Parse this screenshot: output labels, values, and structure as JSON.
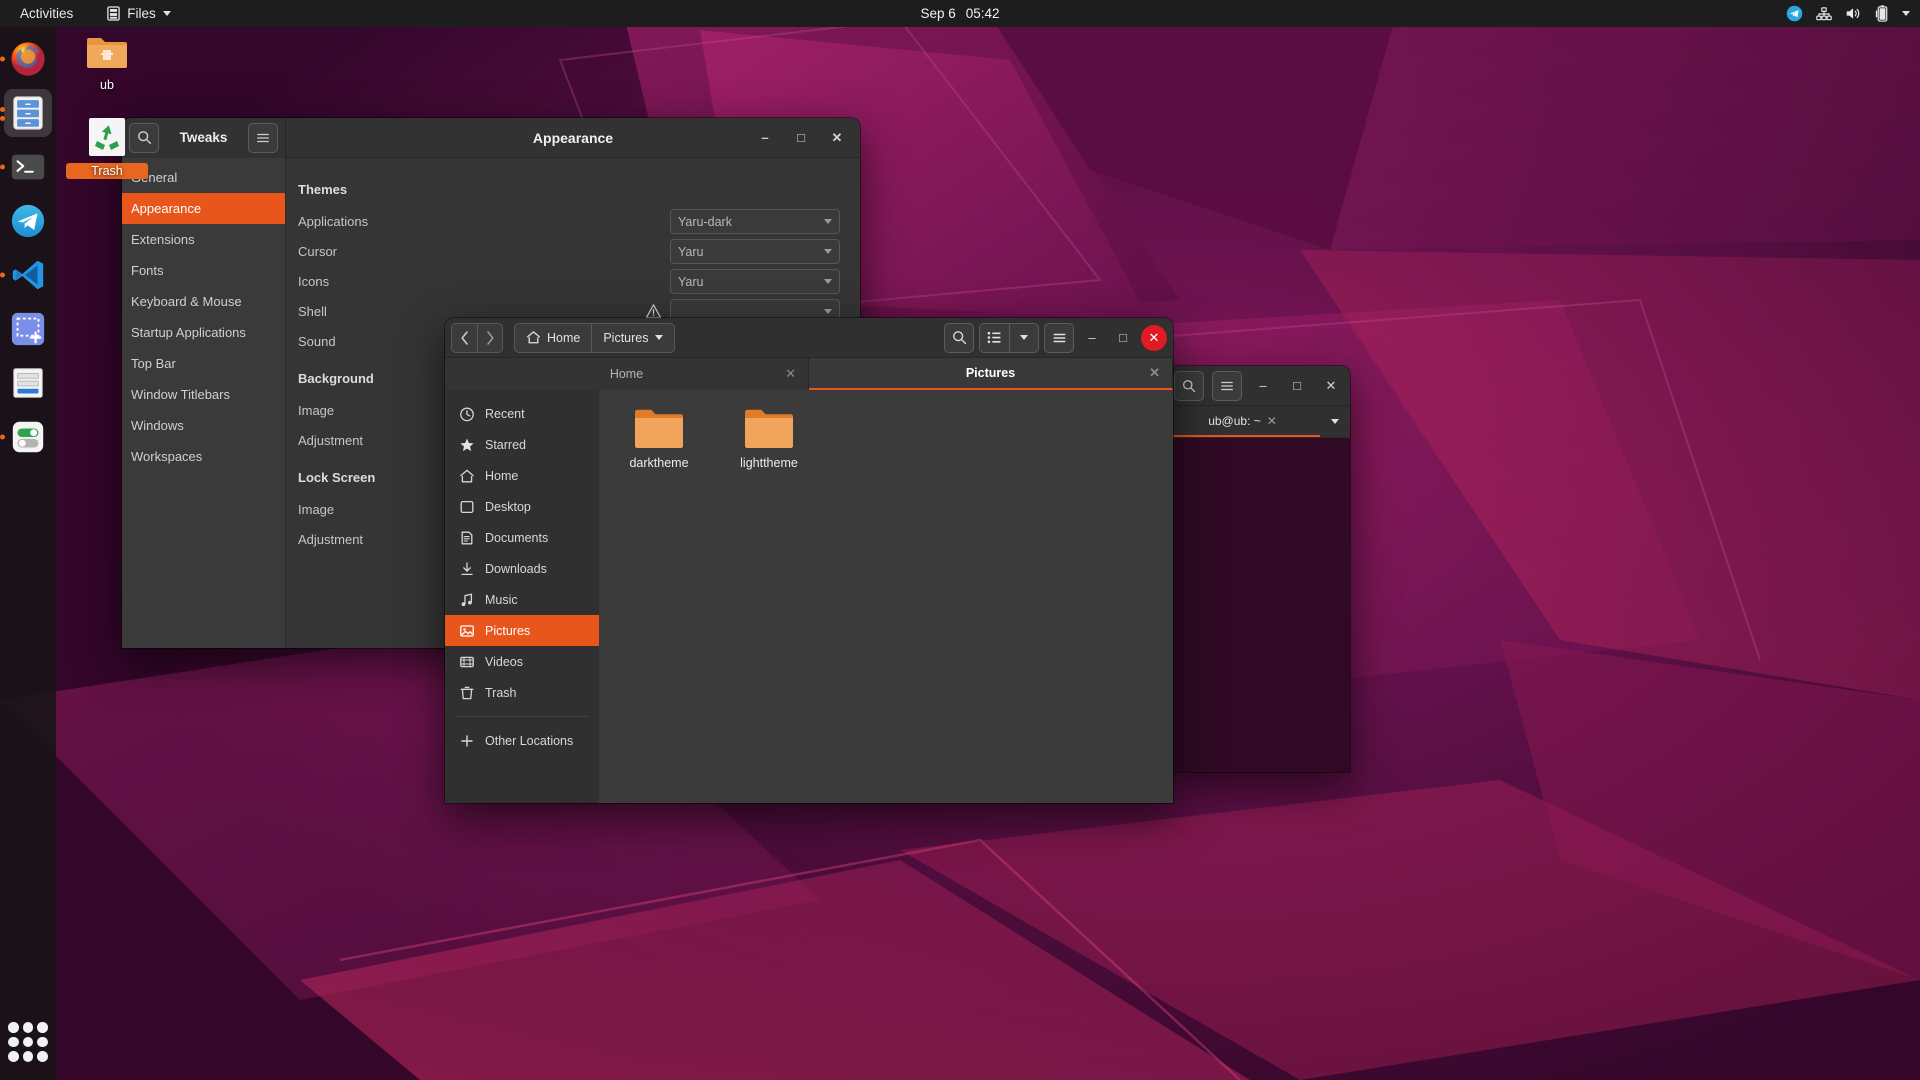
{
  "topbar": {
    "activities": "Activities",
    "app_menu": "Files",
    "app_menu_icon": "files-icon",
    "clock_date": "Sep 6",
    "clock_time": "05:42",
    "indicators": [
      {
        "name": "telegram-icon",
        "label": "Telegram"
      },
      {
        "name": "network-icon",
        "label": "Network"
      },
      {
        "name": "volume-icon",
        "label": "Volume"
      },
      {
        "name": "battery-icon",
        "label": "Battery"
      },
      {
        "name": "chevron-down-icon",
        "label": "System menu"
      }
    ]
  },
  "dock": {
    "items": [
      {
        "name": "firefox",
        "label": "Firefox",
        "running": true,
        "dots": 1,
        "active": false
      },
      {
        "name": "files",
        "label": "Files",
        "running": true,
        "dots": 2,
        "active": true
      },
      {
        "name": "terminal",
        "label": "Terminal",
        "running": true,
        "dots": 1,
        "active": false
      },
      {
        "name": "telegram",
        "label": "Telegram",
        "running": false,
        "dots": 0,
        "active": false
      },
      {
        "name": "vscode",
        "label": "Visual Studio Code",
        "running": true,
        "dots": 1,
        "active": false
      },
      {
        "name": "screenshot",
        "label": "Screenshot",
        "running": false,
        "dots": 0,
        "active": false
      },
      {
        "name": "forms",
        "label": "Forms",
        "running": false,
        "dots": 0,
        "active": false
      },
      {
        "name": "tweaks",
        "label": "Tweaks",
        "running": true,
        "dots": 1,
        "active": false
      }
    ],
    "show_apps_label": "Show Applications"
  },
  "desktop_icons": [
    {
      "name": "ub-folder",
      "label": "ub",
      "type": "folder"
    },
    {
      "name": "trash",
      "label": "Trash",
      "type": "trash"
    }
  ],
  "tweaks": {
    "title": "Tweaks",
    "page_title": "Appearance",
    "search_icon": "search-icon",
    "menu_icon": "hamburger-icon",
    "window_controls": [
      "minimize",
      "maximize",
      "close"
    ],
    "sidebar": [
      {
        "label": "General",
        "active": false
      },
      {
        "label": "Appearance",
        "active": true
      },
      {
        "label": "Extensions",
        "active": false
      },
      {
        "label": "Fonts",
        "active": false
      },
      {
        "label": "Keyboard & Mouse",
        "active": false
      },
      {
        "label": "Startup Applications",
        "active": false
      },
      {
        "label": "Top Bar",
        "active": false
      },
      {
        "label": "Window Titlebars",
        "active": false
      },
      {
        "label": "Windows",
        "active": false
      },
      {
        "label": "Workspaces",
        "active": false
      }
    ],
    "sections": [
      {
        "heading": "Themes",
        "rows": [
          {
            "label": "Applications",
            "value": "Yaru-dark",
            "control": "combo",
            "warning": false
          },
          {
            "label": "Cursor",
            "value": "Yaru",
            "control": "combo",
            "warning": false
          },
          {
            "label": "Icons",
            "value": "Yaru",
            "control": "combo",
            "warning": false
          },
          {
            "label": "Shell",
            "value": "",
            "control": "combo",
            "warning": true
          },
          {
            "label": "Sound",
            "value": "",
            "control": "combo",
            "warning": false
          }
        ]
      },
      {
        "heading": "Background",
        "rows": [
          {
            "label": "Image",
            "value": "",
            "control": "none",
            "warning": false
          },
          {
            "label": "Adjustment",
            "value": "",
            "control": "none",
            "warning": false
          }
        ]
      },
      {
        "heading": "Lock Screen",
        "rows": [
          {
            "label": "Image",
            "value": "",
            "control": "none",
            "warning": false
          },
          {
            "label": "Adjustment",
            "value": "",
            "control": "none",
            "warning": false
          }
        ]
      }
    ]
  },
  "files": {
    "back_icon": "chevron-left-icon",
    "forward_icon": "chevron-right-icon",
    "breadcrumbs": [
      {
        "label": "Home",
        "icon": "home-icon",
        "has_caret": false
      },
      {
        "label": "Pictures",
        "icon": "",
        "has_caret": true
      }
    ],
    "toolbar": [
      {
        "name": "search-icon",
        "label": "Search"
      },
      {
        "name": "list-view-icon",
        "label": "View options"
      },
      {
        "name": "chevron-down-icon",
        "label": "View menu"
      },
      {
        "name": "hamburger-icon",
        "label": "Main menu"
      }
    ],
    "window_controls": [
      "minimize",
      "maximize",
      "close"
    ],
    "tabs": [
      {
        "label": "Home",
        "active": false,
        "closable": true
      },
      {
        "label": "Pictures",
        "active": true,
        "closable": true
      }
    ],
    "sidebar": [
      {
        "label": "Recent",
        "icon": "clock-icon",
        "active": false
      },
      {
        "label": "Starred",
        "icon": "star-icon",
        "active": false
      },
      {
        "label": "Home",
        "icon": "home-icon",
        "active": false
      },
      {
        "label": "Desktop",
        "icon": "desktop-icon",
        "active": false
      },
      {
        "label": "Documents",
        "icon": "document-icon",
        "active": false
      },
      {
        "label": "Downloads",
        "icon": "download-icon",
        "active": false
      },
      {
        "label": "Music",
        "icon": "music-icon",
        "active": false
      },
      {
        "label": "Pictures",
        "icon": "picture-icon",
        "active": true
      },
      {
        "label": "Videos",
        "icon": "video-icon",
        "active": false
      },
      {
        "label": "Trash",
        "icon": "trash-icon",
        "active": false
      }
    ],
    "sidebar_footer": [
      {
        "label": "Other Locations",
        "icon": "plus-icon",
        "active": false
      }
    ],
    "items": [
      {
        "label": "darktheme",
        "type": "folder"
      },
      {
        "label": "lighttheme",
        "type": "folder"
      }
    ]
  },
  "terminal": {
    "tab_label": "ub@ub: ~",
    "toolbar": [
      {
        "name": "search-icon",
        "label": "Search"
      },
      {
        "name": "hamburger-icon",
        "label": "Menu"
      }
    ],
    "window_controls": [
      "minimize",
      "maximize",
      "close"
    ],
    "tab_menu_icon": "chevron-down-icon"
  },
  "colors": {
    "accent": "#e8561c",
    "close_red": "#e01b24",
    "window_bg": "#353535",
    "terminal_bg": "#300a24",
    "folder": "#e9953f"
  }
}
